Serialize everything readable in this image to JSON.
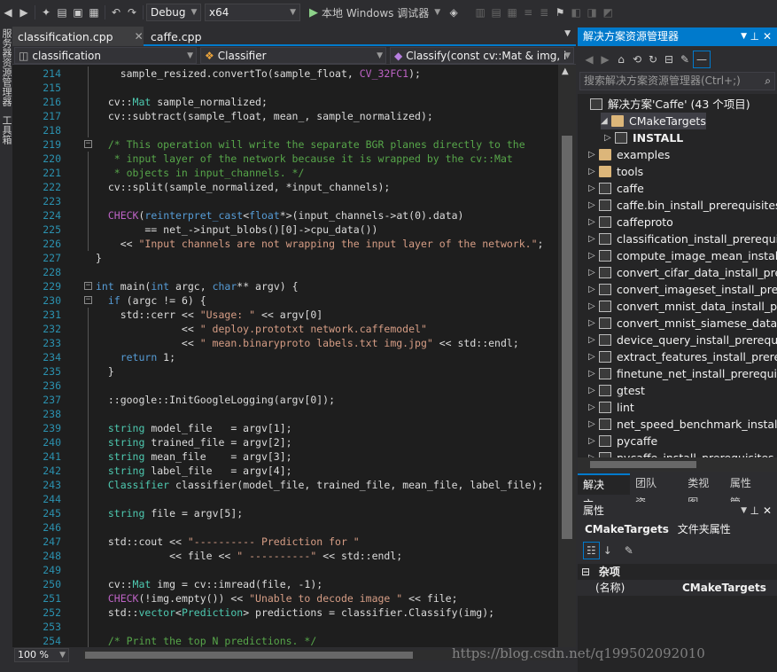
{
  "toolbar": {
    "config": "Debug",
    "platform": "x64",
    "run_label": "本地 Windows 调试器"
  },
  "left_strip": {
    "items": [
      "服务器资源管理器",
      "工具箱"
    ]
  },
  "tabs": [
    {
      "label": "classification.cpp",
      "active": true
    },
    {
      "label": "caffe.cpp",
      "active": false
    }
  ],
  "nav": {
    "project": "classification",
    "scope": "Classifier",
    "member": "Classify(const cv::Mat & img, i"
  },
  "editor": {
    "lines": [
      {
        "n": "214",
        "text": "    sample_resized.convertTo(sample_float, CV_32FC1);"
      },
      {
        "n": "215",
        "text": ""
      },
      {
        "n": "216",
        "text": "  cv::Mat sample_normalized;"
      },
      {
        "n": "217",
        "text": "  cv::subtract(sample_float, mean_, sample_normalized);"
      },
      {
        "n": "218",
        "text": ""
      },
      {
        "n": "219",
        "text": "  /* This operation will write the separate BGR planes directly to the"
      },
      {
        "n": "220",
        "text": "   * input layer of the network because it is wrapped by the cv::Mat"
      },
      {
        "n": "221",
        "text": "   * objects in input_channels. */"
      },
      {
        "n": "222",
        "text": "  cv::split(sample_normalized, *input_channels);"
      },
      {
        "n": "223",
        "text": ""
      },
      {
        "n": "224",
        "text": "  CHECK(reinterpret_cast<float*>(input_channels->at(0).data)"
      },
      {
        "n": "225",
        "text": "        == net_->input_blobs()[0]->cpu_data())"
      },
      {
        "n": "226",
        "text": "    << \"Input channels are not wrapping the input layer of the network.\";"
      },
      {
        "n": "227",
        "text": "}"
      },
      {
        "n": "228",
        "text": ""
      },
      {
        "n": "229",
        "text": "int main(int argc, char** argv) {"
      },
      {
        "n": "230",
        "text": "  if (argc != 6) {"
      },
      {
        "n": "231",
        "text": "    std::cerr << \"Usage: \" << argv[0]"
      },
      {
        "n": "232",
        "text": "              << \" deploy.prototxt network.caffemodel\""
      },
      {
        "n": "233",
        "text": "              << \" mean.binaryproto labels.txt img.jpg\" << std::endl;"
      },
      {
        "n": "234",
        "text": "    return 1;"
      },
      {
        "n": "235",
        "text": "  }"
      },
      {
        "n": "236",
        "text": ""
      },
      {
        "n": "237",
        "text": "  ::google::InitGoogleLogging(argv[0]);"
      },
      {
        "n": "238",
        "text": ""
      },
      {
        "n": "239",
        "text": "  string model_file   = argv[1];"
      },
      {
        "n": "240",
        "text": "  string trained_file = argv[2];"
      },
      {
        "n": "241",
        "text": "  string mean_file    = argv[3];"
      },
      {
        "n": "242",
        "text": "  string label_file   = argv[4];"
      },
      {
        "n": "243",
        "text": "  Classifier classifier(model_file, trained_file, mean_file, label_file);"
      },
      {
        "n": "244",
        "text": ""
      },
      {
        "n": "245",
        "text": "  string file = argv[5];"
      },
      {
        "n": "246",
        "text": ""
      },
      {
        "n": "247",
        "text": "  std::cout << \"---------- Prediction for \""
      },
      {
        "n": "248",
        "text": "            << file << \" ----------\" << std::endl;"
      },
      {
        "n": "249",
        "text": ""
      },
      {
        "n": "250",
        "text": "  cv::Mat img = cv::imread(file, -1);"
      },
      {
        "n": "251",
        "text": "  CHECK(!img.empty()) << \"Unable to decode image \" << file;"
      },
      {
        "n": "252",
        "text": "  std::vector<Prediction> predictions = classifier.Classify(img);"
      },
      {
        "n": "253",
        "text": ""
      },
      {
        "n": "254",
        "text": "  /* Print the top N predictions. */"
      }
    ]
  },
  "zoom": "100 %",
  "solution_explorer": {
    "title": "解决方案资源管理器",
    "search_placeholder": "搜索解决方案资源管理器(Ctrl+;)",
    "solution": "解决方案'Caffe' (43 个项目)",
    "items": [
      "CMakeTargets",
      "INSTALL",
      "examples",
      "tools",
      "caffe",
      "caffe.bin_install_prerequisites",
      "caffeproto",
      "classification_install_prerequi",
      "compute_image_mean_install",
      "convert_cifar_data_install_pre",
      "convert_imageset_install_prer",
      "convert_mnist_data_install_pr",
      "convert_mnist_siamese_data_",
      "device_query_install_prerequ",
      "extract_features_install_prere",
      "finetune_net_install_prerequis",
      "gtest",
      "lint",
      "net_speed_benchmark_install",
      "pycaffe",
      "pycaffe_install_prerequisites"
    ],
    "tabs": [
      "解决方...",
      "团队资...",
      "类视图",
      "属性管..."
    ]
  },
  "properties": {
    "title": "属性",
    "object_name": "CMakeTargets",
    "object_type": "文件夹属性",
    "category": "杂项",
    "rows": [
      {
        "name": "(名称)",
        "value": "CMakeTargets"
      }
    ]
  },
  "watermark": "https://blog.csdn.net/q199502092010"
}
